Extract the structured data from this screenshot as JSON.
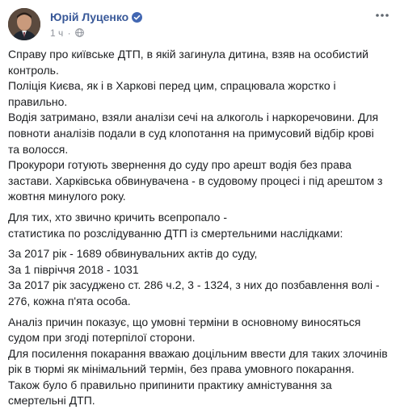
{
  "author": {
    "name": "Юрій Луценко",
    "verified_icon": "verified-badge-icon"
  },
  "meta": {
    "time": "1 ч",
    "separator": "·",
    "privacy_icon": "globe-icon"
  },
  "post": {
    "paragraphs": [
      "Справу про київське ДТП, в якій загинула дитина, взяв на особистий контроль.\nПоліція Києва, як і в Харкові перед цим, спрацювала жорстко і правильно.\nВодія затримано, взяли аналізи сечі на алкоголь і наркоречовини. Для повноти аналізів подали в суд клопотання на примусовий відбір крові та волосся.\nПрокурори готують звернення до суду про арешт водія без права застави. Харківська обвинувачена - в судовому процесі і під арештом з жовтня минулого року.",
      "Для тих, хто звично кричить всепропало -\nстатистика по розслідуванню ДТП із смертельними наслідками:",
      "За 2017 рік - 1689 обвинувальних актів до суду,\nЗа 1 півріччя 2018 - 1031\nЗа 2017 рік засуджено ст. 286 ч.2, 3 - 1324, з них до позбавлення волі - 276, кожна п'ята особа.",
      "Аналіз причин показує, що умовні терміни в основному виносяться судом при згоді потерпілої сторони.\nДля посилення покарання вважаю доцільним ввести для таких злочинів рік в тюрмі як мінімальний термін, без права умовного покарання.\nТакож було б правильно припинити практику амністування за смертельні ДТП."
    ]
  },
  "colors": {
    "author_link": "#385898",
    "text": "#1c1e21",
    "meta": "#90949c",
    "verified": "#4267b2"
  }
}
